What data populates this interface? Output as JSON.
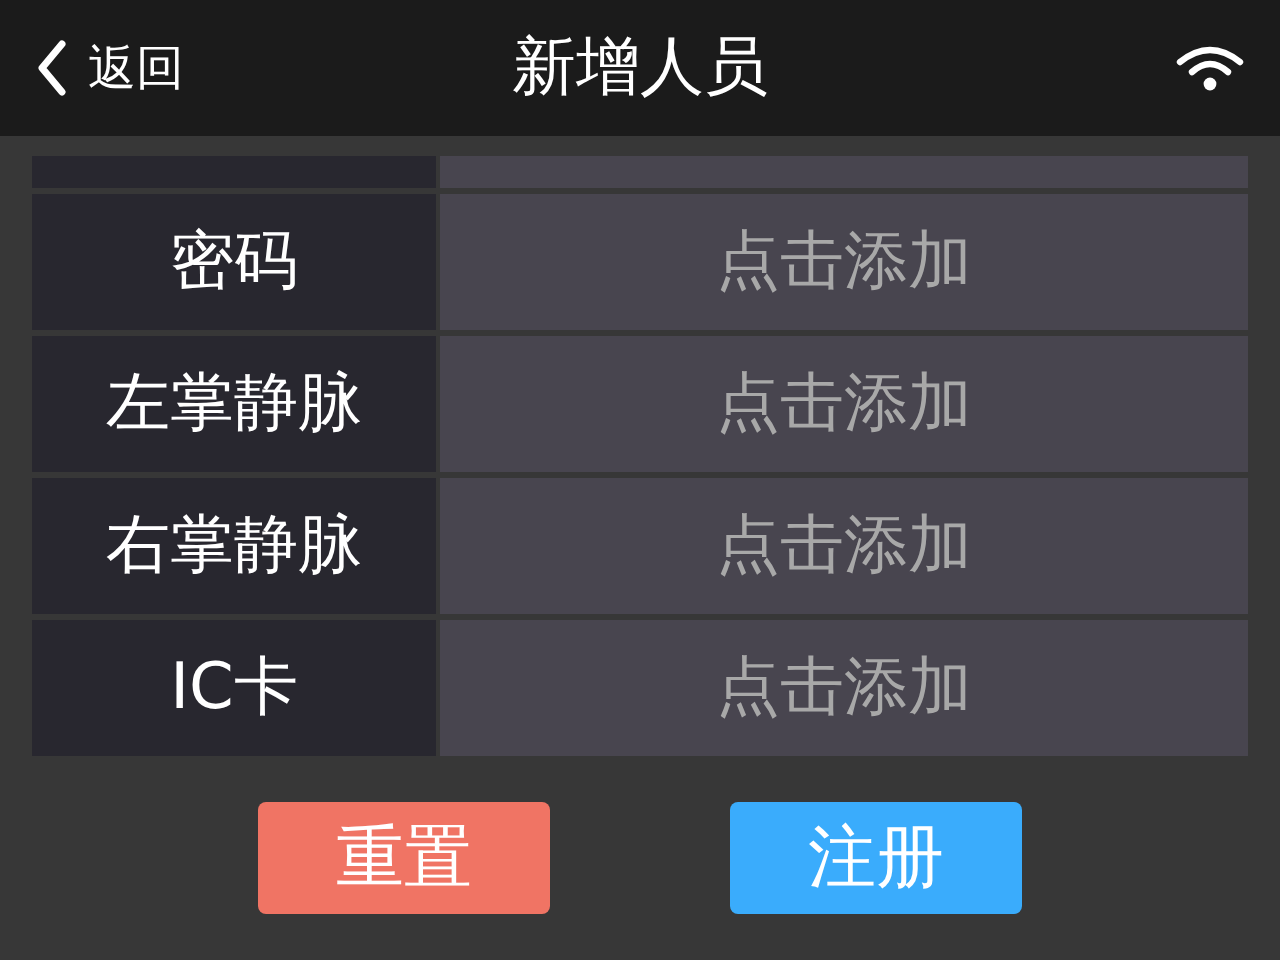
{
  "header": {
    "back": "返回",
    "title": "新增人员"
  },
  "rows": [
    {
      "label": "密码",
      "value": "点击添加"
    },
    {
      "label": "左掌静脉",
      "value": "点击添加"
    },
    {
      "label": "右掌静脉",
      "value": "点击添加"
    },
    {
      "label": "IC卡",
      "value": "点击添加"
    }
  ],
  "buttons": [
    {
      "label": "重置",
      "kind": "reset"
    },
    {
      "label": "注册",
      "kind": "submit"
    }
  ]
}
